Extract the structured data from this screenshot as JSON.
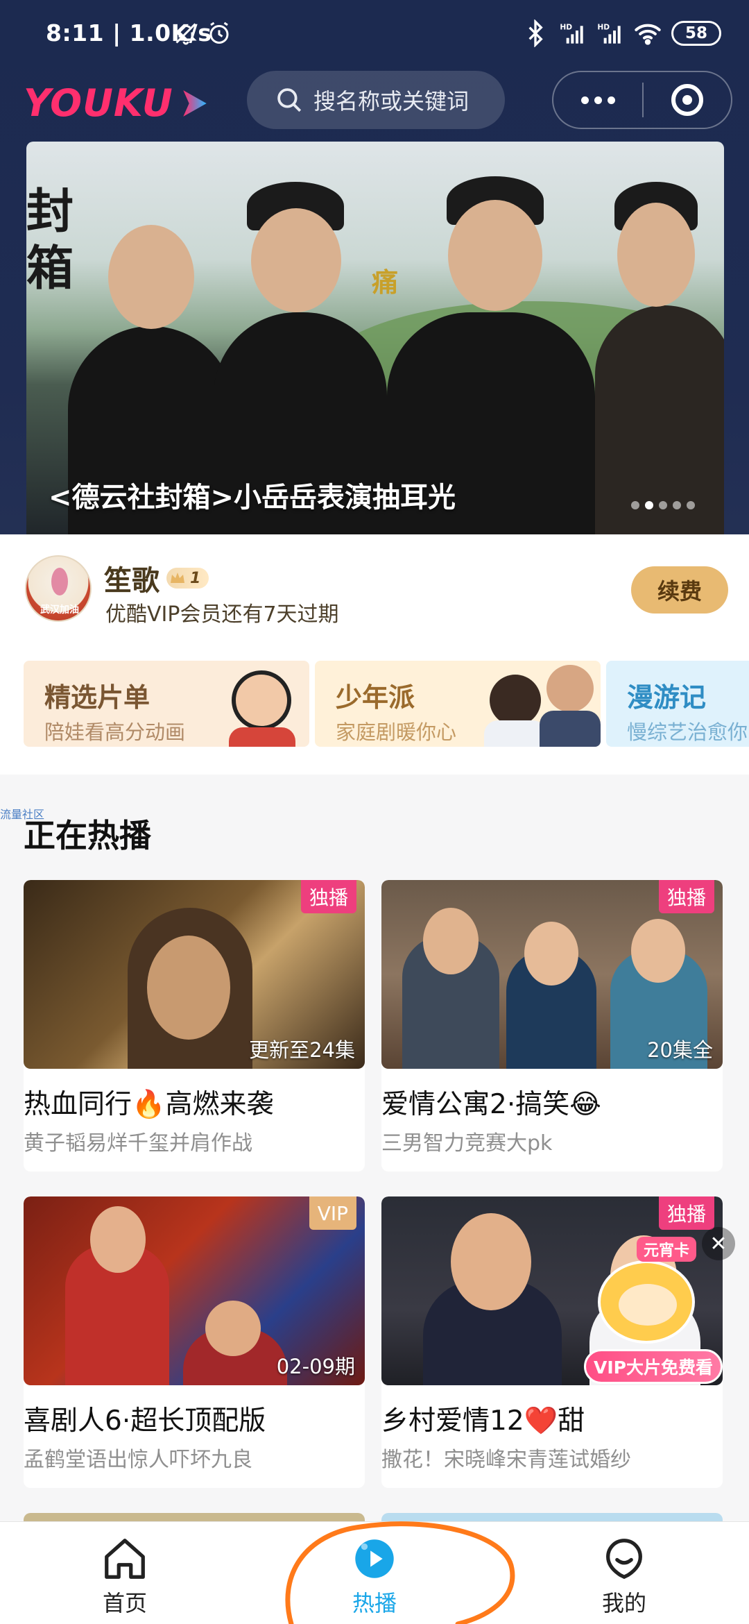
{
  "status_bar": {
    "time": "8:11 | 1.0K/s",
    "battery": "58",
    "icons": [
      "mute-bell-icon",
      "alarm-icon",
      "bluetooth-icon",
      "signal-hd-icon",
      "signal-hd-icon",
      "wifi-icon",
      "battery-icon"
    ]
  },
  "header": {
    "logo_text": "YOUKU",
    "search_placeholder": "搜名称或关键词"
  },
  "banner": {
    "caption": "<德云社封箱>小岳岳表演抽耳光",
    "seal_text": "封箱",
    "overlay_text": "痛",
    "pages": 5,
    "active_page": 1
  },
  "vip": {
    "username": "笙歌",
    "level": "1",
    "expire_text": "优酷VIP会员还有7天过期",
    "renew_label": "续费",
    "avatar_text": "武汉加油"
  },
  "feature_cards": [
    {
      "title": "精选片单",
      "subtitle": "陪娃看高分动画"
    },
    {
      "title": "少年派",
      "subtitle": "家庭剧暖你心"
    },
    {
      "title": "漫游记",
      "subtitle": "慢综艺治愈你"
    }
  ],
  "side_tag": "流量社区",
  "section": {
    "title": "正在热播"
  },
  "shows": [
    {
      "badge": "独播",
      "badge_style": "pink",
      "episode": "更新至24集",
      "title": "热血同行🔥高燃来袭",
      "subtitle": "黄子韬易烊千玺并肩作战"
    },
    {
      "badge": "独播",
      "badge_style": "pink",
      "episode": "20集全",
      "title": "爱情公寓2·搞笑😂",
      "subtitle": "三男智力竞赛大pk"
    },
    {
      "badge": "VIP",
      "badge_style": "gold",
      "episode": "02-09期",
      "title": "喜剧人6·超长顶配版",
      "subtitle": "孟鹤堂语出惊人吓坏九良"
    },
    {
      "badge": "独播",
      "badge_style": "pink",
      "episode": "",
      "title": "乡村爱情12❤️甜",
      "subtitle": "撒花！宋晓峰宋青莲试婚纱"
    }
  ],
  "promo": {
    "tag": "元宵卡",
    "label": "VIP大片免费看"
  },
  "close_label": "✕",
  "tabbar": {
    "items": [
      {
        "label": "首页",
        "icon": "home-icon",
        "active": false
      },
      {
        "label": "热播",
        "icon": "play-circle-icon",
        "active": true
      },
      {
        "label": "我的",
        "icon": "smiley-face-icon",
        "active": false
      }
    ]
  },
  "colors": {
    "header_bg": "#1f2c52",
    "brand_pink": "#ff2f6e",
    "badge_pink": "#ee3f7e",
    "vip_gold": "#e8ba72",
    "active_tab": "#19a6e8",
    "annotation": "#ff7a1a"
  }
}
